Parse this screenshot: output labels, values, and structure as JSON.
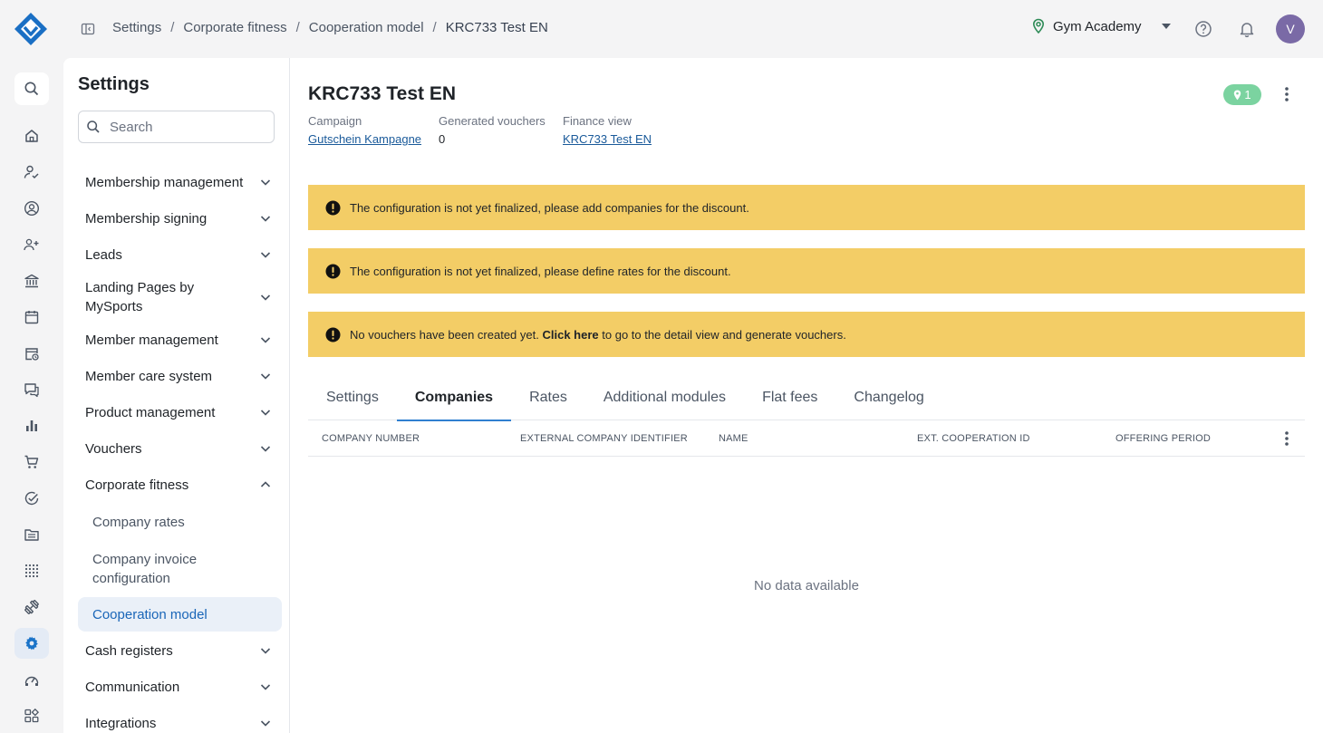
{
  "breadcrumb": [
    "Settings",
    "Corporate fitness",
    "Cooperation model",
    "KRC733 Test EN"
  ],
  "header": {
    "studio": "Gym Academy",
    "avatar_initial": "V"
  },
  "sidebar": {
    "title": "Settings",
    "search_placeholder": "Search",
    "items": [
      {
        "label": "Membership management",
        "expanded": false
      },
      {
        "label": "Membership signing",
        "expanded": false
      },
      {
        "label": "Leads",
        "expanded": false
      },
      {
        "label": "Landing Pages by MySports",
        "expanded": false
      },
      {
        "label": "Member management",
        "expanded": false
      },
      {
        "label": "Member care system",
        "expanded": false
      },
      {
        "label": "Product management",
        "expanded": false
      },
      {
        "label": "Vouchers",
        "expanded": false
      },
      {
        "label": "Corporate fitness",
        "expanded": true
      },
      {
        "label": "Cash registers",
        "expanded": false
      },
      {
        "label": "Communication",
        "expanded": false
      },
      {
        "label": "Integrations",
        "expanded": false
      }
    ],
    "corporate_children": [
      {
        "label": "Company rates",
        "active": false
      },
      {
        "label": "Company invoice configuration",
        "active": false
      },
      {
        "label": "Cooperation model",
        "active": true
      }
    ]
  },
  "main": {
    "title": "KRC733 Test EN",
    "badge_count": "1",
    "meta": {
      "campaign_label": "Campaign",
      "campaign_value": "Gutschein Kampagne",
      "vouchers_label": "Generated vouchers",
      "vouchers_value": "0",
      "finance_label": "Finance view",
      "finance_value": "KRC733 Test EN"
    },
    "alerts": {
      "a1": "The configuration is not yet finalized, please add companies for the discount.",
      "a2": "The configuration is not yet finalized, please define rates for the discount.",
      "a3_before": "No vouchers have been created yet.",
      "a3_link": "Click here",
      "a3_after": "to go to the detail view and generate vouchers."
    },
    "tabs": [
      "Settings",
      "Companies",
      "Rates",
      "Additional modules",
      "Flat fees",
      "Changelog"
    ],
    "active_tab": "Companies",
    "columns": [
      "Company number",
      "External company identifier",
      "Name",
      "Ext. cooperation ID",
      "Offering period"
    ],
    "empty_text": "No data available"
  },
  "colors": {
    "accent": "#2f7fd0",
    "alert": "#f3cd66",
    "badge": "#7bd3a0",
    "avatar": "#7a6aa6"
  }
}
